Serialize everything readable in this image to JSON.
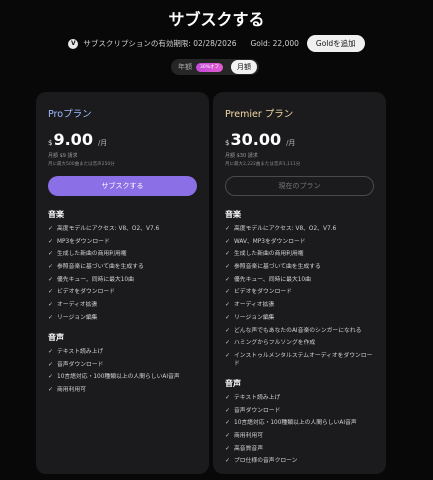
{
  "page": {
    "title": "サブスクする"
  },
  "subscription_bar": {
    "badge": "V",
    "expiry": "サブスクリプションの有効期限: 02/28/2026",
    "gold": "Gold: 22,000",
    "add_gold": "Goldを追加"
  },
  "billing_toggle": {
    "yearly": "年額",
    "discount": "30%オフ",
    "monthly": "月額",
    "selected": "月額"
  },
  "plans": [
    {
      "name": "Proプラン",
      "currency": "$",
      "price": "9.00",
      "per": "/月",
      "billing_note": "月額 $9 請求",
      "limit_note": "月に最大500曲または音声250分",
      "cta": "サブスクする",
      "sections": [
        {
          "title": "音楽",
          "items": [
            "高度モデルにアクセス: V8、O2、V7.6",
            "MP3をダウンロード",
            "生成した新曲の商用利用権",
            "参照音楽に基づいて曲を生成する",
            "優先キュー、同時に最大10曲",
            "ビデオをダウンロード",
            "オーディオ拡張",
            "リージョン編集"
          ]
        },
        {
          "title": "音声",
          "items": [
            "テキスト読み上げ",
            "音声ダウンロード",
            "10言語対応・100種類以上の人間らしいAI音声",
            "商用利用可"
          ]
        }
      ]
    },
    {
      "name": "Premier プラン",
      "currency": "$",
      "price": "30.00",
      "per": "/月",
      "billing_note": "月額 $30 請求",
      "limit_note": "月に最大2,222曲または音声1,111分",
      "cta": "現在のプラン",
      "sections": [
        {
          "title": "音楽",
          "items": [
            "高度モデルにアクセス: V8、O2、V7.6",
            "WAV、MP3をダウンロード",
            "生成した新曲の商用利用権",
            "参照音楽に基づいて曲を生成する",
            "優先キュー、同時に最大10曲",
            "ビデオをダウンロード",
            "オーディオ拡張",
            "リージョン編集",
            "どんな声でもあなたのAI音楽のシンガーになれる",
            "ハミングからフルソングを作成",
            "インストゥルメンタルステムオーディオをダウンロード"
          ]
        },
        {
          "title": "音声",
          "items": [
            "テキスト読み上げ",
            "音声ダウンロード",
            "10言語対応・100種類以上の人間らしいAI音声",
            "商用利用可",
            "高音質音声",
            "プロ仕様の音声クローン"
          ]
        }
      ]
    }
  ]
}
